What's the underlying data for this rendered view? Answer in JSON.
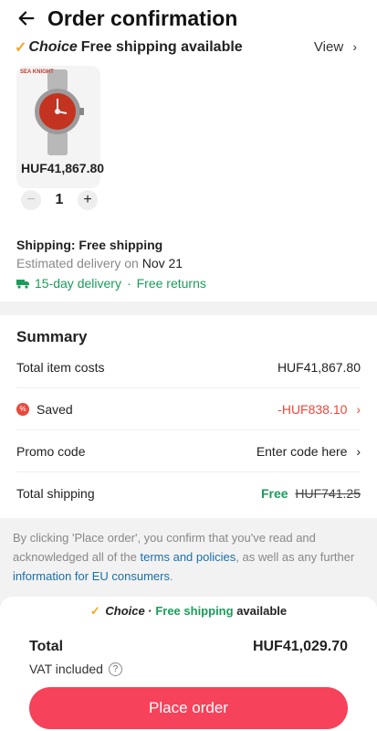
{
  "header": {
    "title": "Order confirmation"
  },
  "product": {
    "choice_check": "✓",
    "choice_badge": "Choice",
    "shipping_note": "Free shipping available",
    "view_label": "View",
    "brand_text": "SEA KNIGHT",
    "price": "HUF41,867.80",
    "quantity": "1"
  },
  "shipping": {
    "title": "Shipping: Free shipping",
    "estimated_label": "Estimated delivery on",
    "estimated_date": "Nov 21",
    "delivery": "15-day delivery",
    "separator": "·",
    "returns": "Free returns"
  },
  "summary": {
    "title": "Summary",
    "rows": [
      {
        "label": "Total item costs",
        "value": "HUF41,867.80"
      },
      {
        "label": "Saved",
        "value": "-HUF838.10"
      },
      {
        "label": "Promo code",
        "value": "Enter code here"
      },
      {
        "label": "Total shipping",
        "value": "Free",
        "strike": "HUF741.25"
      }
    ]
  },
  "legal": {
    "text1": "By clicking 'Place order', you confirm that you've read and acknowledged all of the ",
    "link1": "terms and policies",
    "text2": ", as well as any further ",
    "link2": "information for EU consumers",
    "text3": "."
  },
  "bottom": {
    "choice_check": "✓",
    "choice_badge": "Choice",
    "dot": " · ",
    "free_shipping": "Free shipping",
    "available": " available",
    "total_label": "Total",
    "total_value": "HUF41,029.70",
    "vat_label": "VAT included",
    "place_order": "Place order"
  },
  "colors": {
    "accent": "#f6425a",
    "green": "#1a9c5b",
    "red": "#e8493d",
    "link": "#1a6fa8"
  },
  "icons": [
    "back-arrow-icon",
    "chevron-right-icon",
    "truck-icon",
    "saved-icon",
    "question-icon",
    "minus-icon",
    "plus-icon"
  ]
}
